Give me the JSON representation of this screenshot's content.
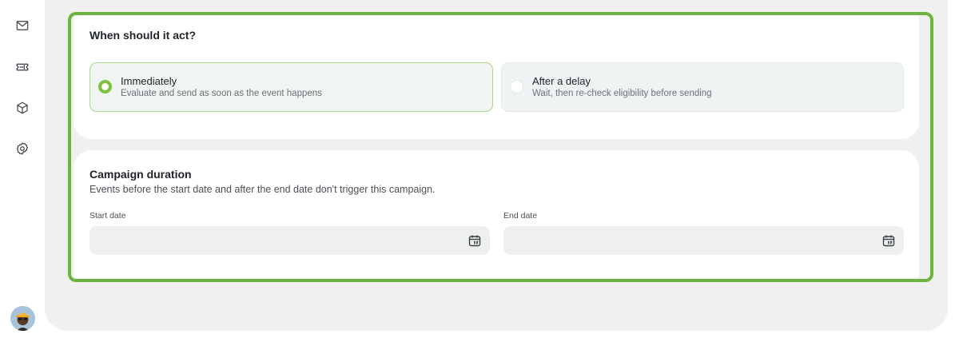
{
  "sidebar": {
    "icons": [
      "mail-icon",
      "ticket-icon",
      "cube-icon",
      "settings-icon"
    ],
    "avatar": "user-avatar"
  },
  "timing": {
    "title": "When should it act?",
    "options": [
      {
        "label": "Immediately",
        "description": "Evaluate and send as soon as the event happens",
        "selected": true
      },
      {
        "label": "After a delay",
        "description": "Wait, then re-check eligibility before sending",
        "selected": false
      }
    ]
  },
  "duration": {
    "title": "Campaign duration",
    "subtitle": "Events before the start date and after the end date don't trigger this campaign.",
    "start_label": "Start date",
    "start_value": "",
    "end_label": "End date",
    "end_value": ""
  },
  "colors": {
    "accent_green": "#6db33f",
    "radio_green": "#7cc23c",
    "page_bg": "#f0f0f0",
    "card_bg": "#ffffff"
  }
}
